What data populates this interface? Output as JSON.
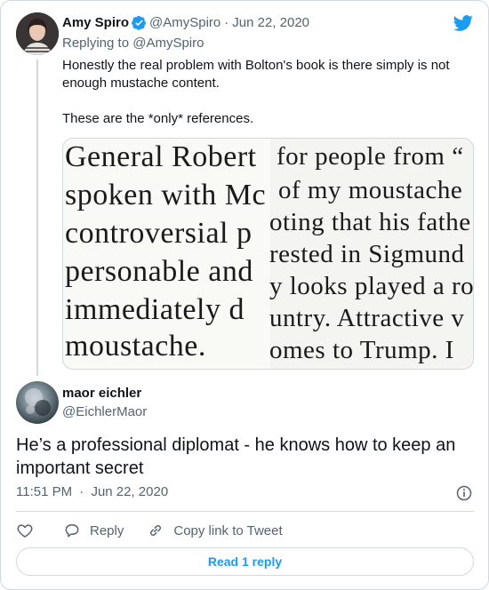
{
  "parent_tweet": {
    "author_name": "Amy Spiro",
    "handle": "@AmySpiro",
    "separator": "·",
    "date": "Jun 22, 2020",
    "replying_label": "Replying to",
    "replying_to": "@AmySpiro",
    "text_1": "Honestly the real problem with Bolton's book is there simply is not enough mustache content.",
    "text_2": "These are the *only* references.",
    "image": {
      "left_lines": [
        "General Robert",
        "spoken with Mc",
        "controversial p",
        "personable and",
        "immediately  d",
        "moustache."
      ],
      "right_lines": [
        "for people from “",
        "of my moustache",
        "oting that his fathe",
        "rested in Sigmund",
        "y looks played a ro",
        "untry. Attractive v",
        "omes to Trump. I"
      ]
    }
  },
  "main_tweet": {
    "author_name": "maor eichler",
    "handle": "@EichlerMaor",
    "text": "He’s a professional diplomat - he knows how to keep an important secret",
    "time": "11:51 PM",
    "separator": "·",
    "date": "Jun 22, 2020"
  },
  "actions": {
    "like_icon": "heart-icon",
    "reply_label": "Reply",
    "copy_label": "Copy link to Tweet"
  },
  "read_replies_label": "Read 1 reply",
  "colors": {
    "accent": "#1d9bf0",
    "text": "#0f1419",
    "secondary": "#536471",
    "border": "#cfd9de"
  }
}
